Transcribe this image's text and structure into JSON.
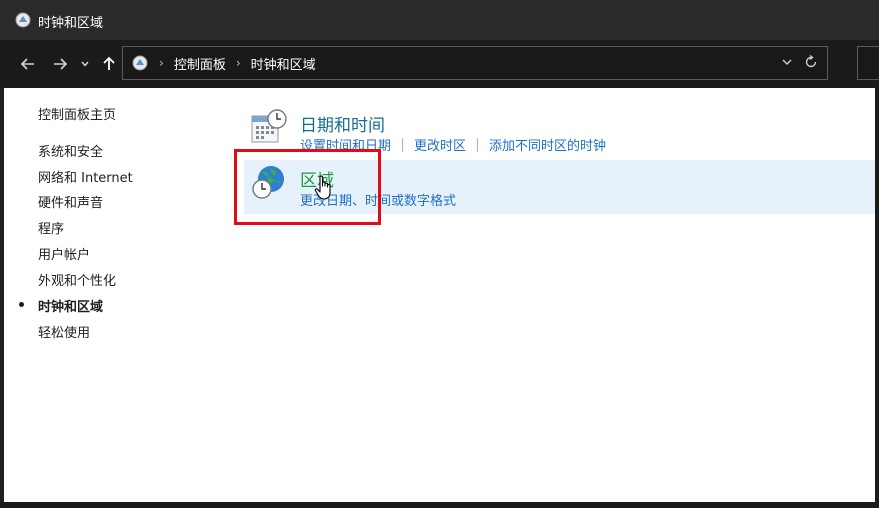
{
  "window": {
    "title": "时钟和区域"
  },
  "nav": {
    "back_icon": "arrow-left-icon",
    "forward_icon": "arrow-right-icon",
    "recent_icon": "chevron-down-icon",
    "up_icon": "arrow-up-icon"
  },
  "address": {
    "crumbs": [
      "控制面板",
      "时钟和区域"
    ],
    "separator": "›"
  },
  "sidebar": {
    "home": "控制面板主页",
    "items": [
      "系统和安全",
      "网络和 Internet",
      "硬件和声音",
      "程序",
      "用户帐户",
      "外观和个性化",
      "时钟和区域",
      "轻松使用"
    ],
    "active": "时钟和区域"
  },
  "categories": [
    {
      "title": "日期和时间",
      "icon": "calendar-clock-icon",
      "links": [
        "设置时间和日期",
        "更改时区",
        "添加不同时区的时钟"
      ]
    },
    {
      "title": "区域",
      "icon": "globe-clock-icon",
      "links": [
        "更改日期、时间或数字格式"
      ]
    }
  ],
  "colors": {
    "highlight_border": "#e10d16",
    "link": "#1e6fc4",
    "title_teal": "#166e8d",
    "title_green": "#1a9b3c",
    "hover_bg": "#e6f1fb"
  }
}
